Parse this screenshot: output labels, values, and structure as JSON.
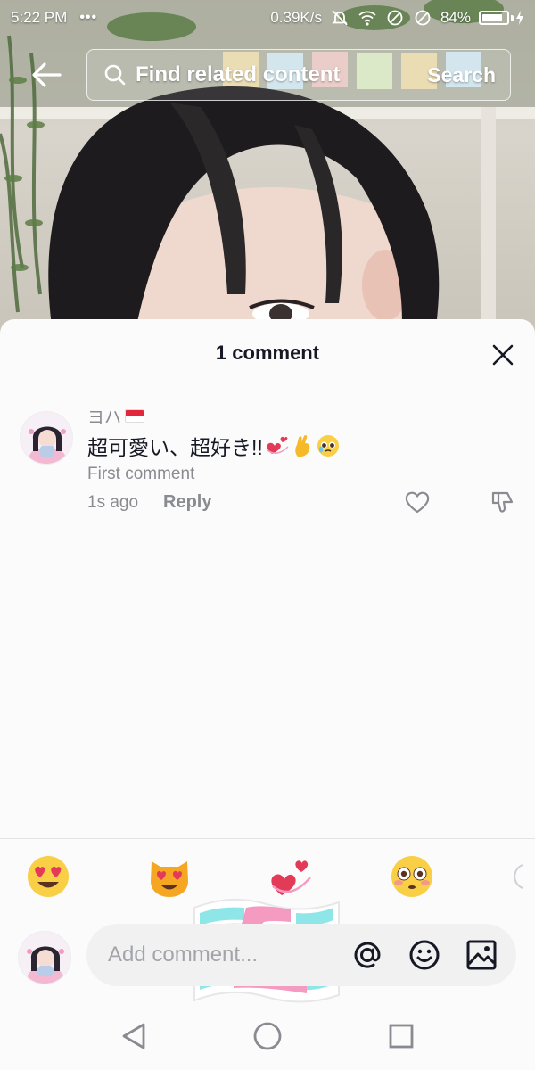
{
  "status_bar": {
    "time": "5:22 PM",
    "dots": "•••",
    "network_speed": "0.39K/s",
    "battery_percent": "84%",
    "battery_level": 0.84
  },
  "search": {
    "placeholder": "Find related content",
    "button_label": "Search"
  },
  "comments_panel": {
    "title": "1 comment",
    "comments": [
      {
        "username": "ヨハ",
        "text": "超可愛い、超好き!!",
        "label": "First comment",
        "time": "1s ago",
        "reply_label": "Reply"
      }
    ]
  },
  "quick_emojis": [
    "😍",
    "😻",
    "💞",
    "😳"
  ],
  "comment_input": {
    "placeholder": "Add comment..."
  },
  "colors": {
    "sheet_background": "#fbfbfc",
    "primary_text": "#161823",
    "secondary_text": "#8a8b91",
    "input_background": "#f1f1f2",
    "sticker_cyan": "#8ee6e8",
    "sticker_pink": "#f59ac0"
  },
  "icons": [
    "back-arrow-icon",
    "search-icon",
    "close-icon",
    "heart-icon",
    "dislike-icon",
    "at-icon",
    "emoji-icon",
    "image-icon",
    "nav-back-icon",
    "nav-home-icon",
    "nav-recent-icon"
  ]
}
